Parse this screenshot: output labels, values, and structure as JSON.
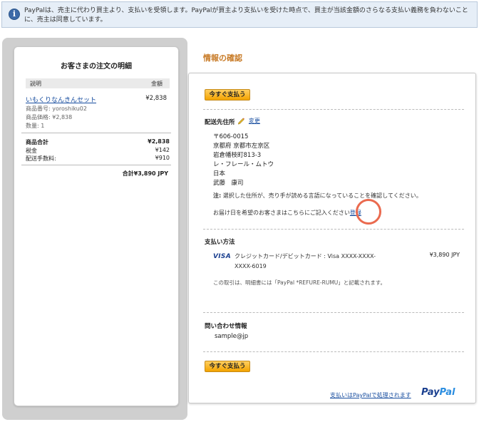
{
  "info_banner": {
    "text": "PayPalは、売主に代わり買主より、支払いを受領します。PayPalが買主より支払いを受けた時点で、買主が当該金額のさらなる支払い義務を負わないことに、売主は同意しています。"
  },
  "order": {
    "title": "お客さまの注文の明細",
    "col_description": "説明",
    "col_amount": "金額",
    "item_name": "いもくりなんきんセット",
    "item_amount": "¥2,838",
    "item_number": "商品番号: yoroshiku02",
    "item_price": "商品価格: ¥2,838",
    "item_qty": "数量: 1",
    "subtotal_label": "商品合計",
    "subtotal_value": "¥2,838",
    "tax_label": "税金",
    "tax_value": "¥142",
    "shipping_label": "配送手数料:",
    "shipping_value": "¥910",
    "total": "合計¥3,890 JPY"
  },
  "review": {
    "title": "情報の確認",
    "pay_now_label": "今すぐ支払う",
    "shipping_title": "配送先住所",
    "edit_label": "変更",
    "address": [
      "〒606-0015",
      "京都府 京都市左京区",
      "岩倉幡枝町813-3",
      "レ・フレール・ムトウ",
      "日本",
      "武藤　康司"
    ],
    "note_bold": "注:",
    "note_text": " 選択した住所が、売り手が読める言語になっていることを確認してください。",
    "delivery_text": "お届け日を希望のお客さまはこちらにご記入ください",
    "register_link": "登録",
    "payment_title": "支払い方法",
    "card_brand": "VISA",
    "card_text": "クレジットカード/デビットカード : Visa XXXX-XXXX-XXXX-6019",
    "card_amount": "¥3,890 JPY",
    "billing_note": "この取引は、明細書には「PayPal *REFURE-RUMU」と記載されます。",
    "contact_title": "問い合わせ情報",
    "email": "sample@jp",
    "footer_link": "支払いはPayPalで処理されます",
    "logo_pay": "Pay",
    "logo_pal": "Pal"
  },
  "colors": {
    "accent_orange": "#c87b27",
    "button": "#f3a300",
    "link": "#1a4fa0",
    "highlight_circle": "#ea6a4f"
  }
}
